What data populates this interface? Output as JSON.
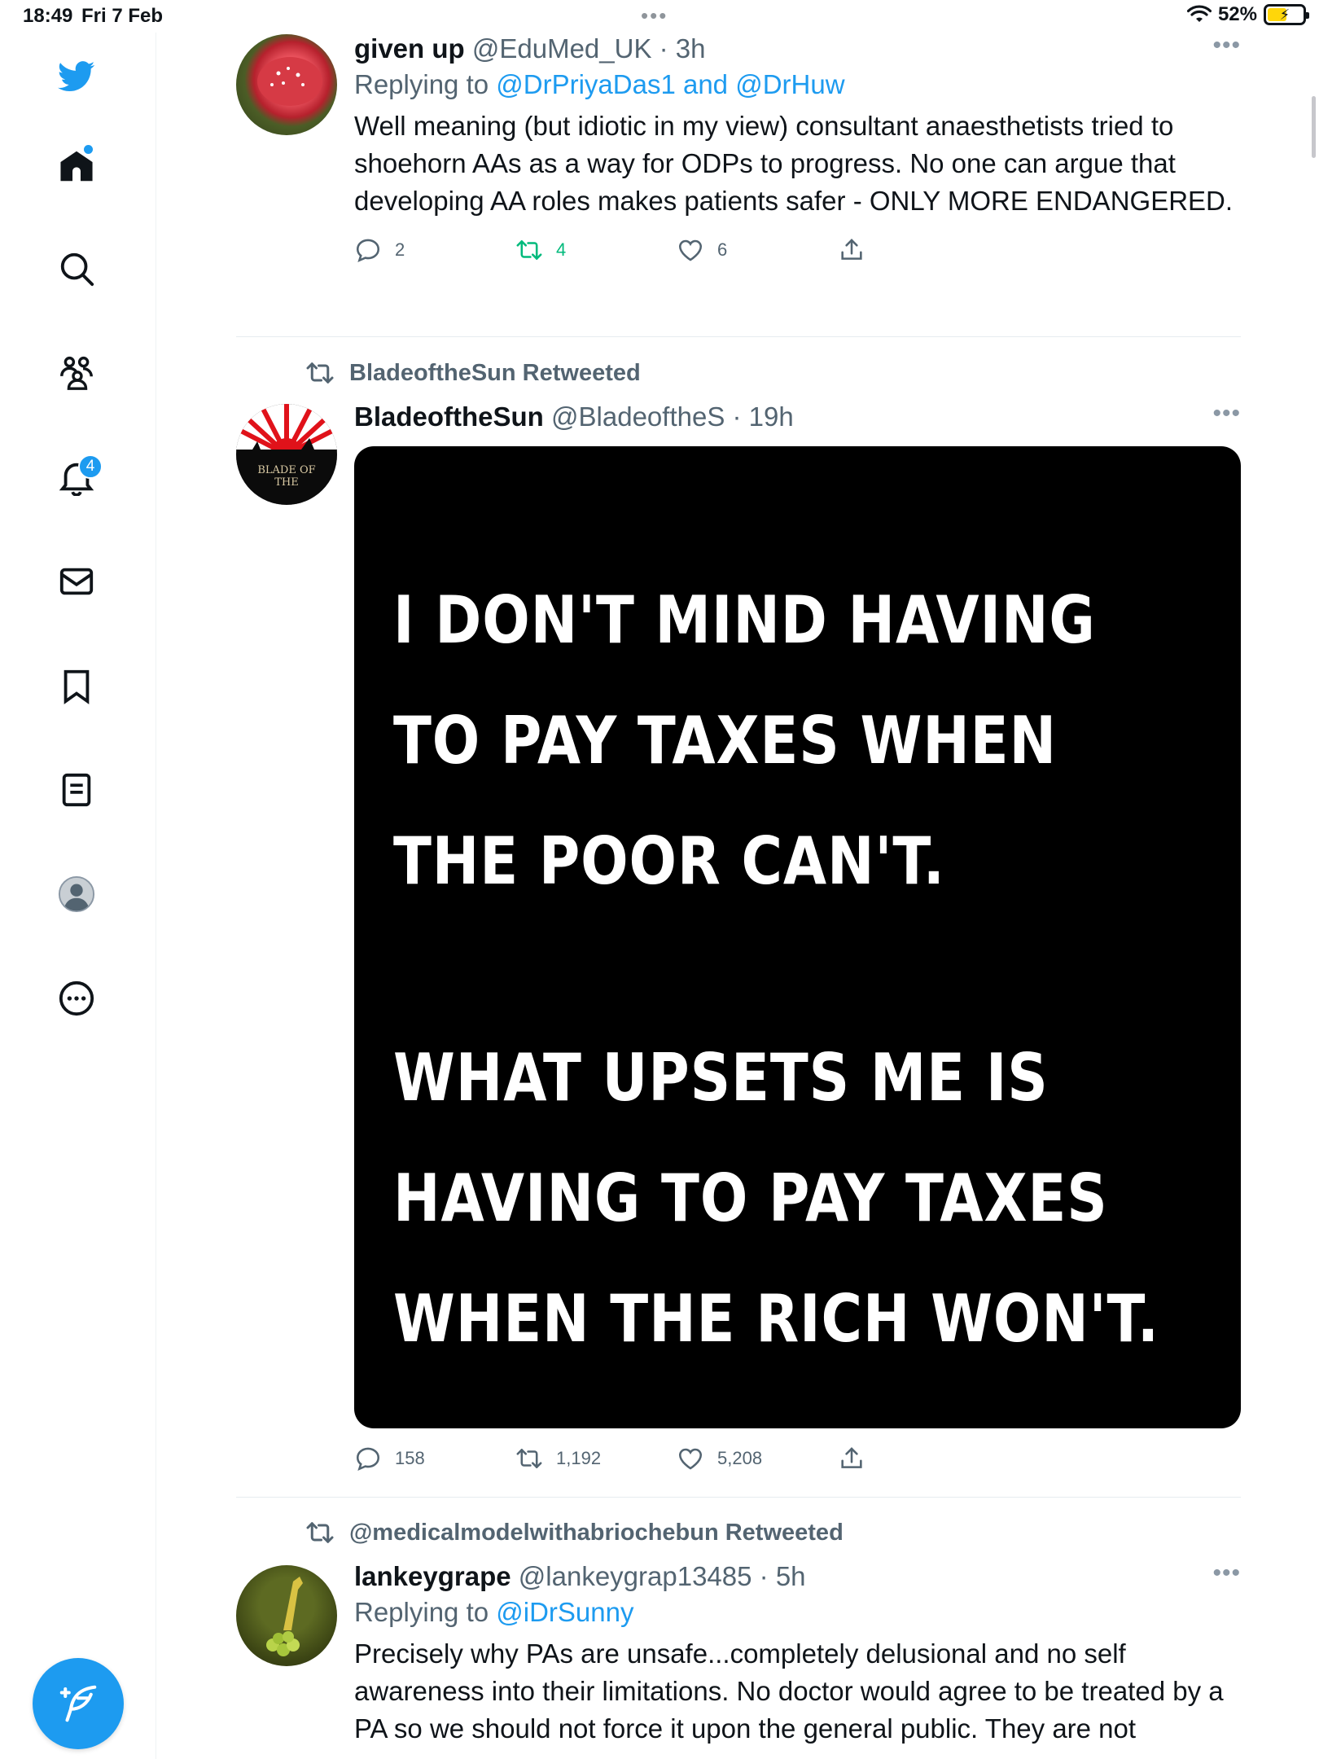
{
  "status_bar": {
    "time": "18:49",
    "date": "Fri 7 Feb",
    "battery": "52%",
    "dots": "•••"
  },
  "sidebar": {
    "icons": [
      "twitter-logo-icon",
      "home-icon",
      "search-icon",
      "communities-icon",
      "notifications-icon",
      "messages-icon",
      "bookmarks-icon",
      "lists-icon",
      "profile-icon",
      "more-icon"
    ],
    "notifications_badge": "4"
  },
  "colors": {
    "accent": "#1d9bf0",
    "retweet_green": "#00ba7c",
    "secondary_text": "#536471"
  },
  "tweets": [
    {
      "name": "given up",
      "handle": "@EduMed_UK",
      "time": "· 3h",
      "replying_prefix": "Replying to ",
      "replying_mentions": "@DrPriyaDas1 and @DrHuw",
      "text": "Well meaning (but idiotic in my view) consultant anaesthetists tried to shoehorn AAs as a way for ODPs to progress. No one can argue that developing AA roles makes patients safer - ONLY MORE ENDANGERED.",
      "replies": "2",
      "retweets": "4",
      "likes": "6"
    },
    {
      "social_context": "BladeoftheSun Retweeted",
      "name": "BladeoftheSun",
      "handle": "@BladeoftheS",
      "time": "· 19h",
      "avatar_text": "BLADE OF THE",
      "media_lines": [
        "I DON'T MIND HAVING",
        "TO PAY TAXES WHEN",
        "THE POOR CAN'T.",
        "WHAT UPSETS ME IS",
        "HAVING TO PAY TAXES",
        "WHEN THE RICH WON'T."
      ],
      "replies": "158",
      "retweets": "1,192",
      "likes": "5,208"
    },
    {
      "social_context": "@medicalmodelwithabriochebun Retweeted",
      "name": "lankeygrape",
      "handle": "@lankeygrap13485",
      "time": "· 5h",
      "replying_prefix": "Replying to ",
      "replying_mentions": "@iDrSunny",
      "text": "Precisely why PAs are unsafe...completely delusional and no self awareness into their limitations. No doctor would agree to be treated by a PA so we should not force it upon the general public. They are not"
    }
  ]
}
